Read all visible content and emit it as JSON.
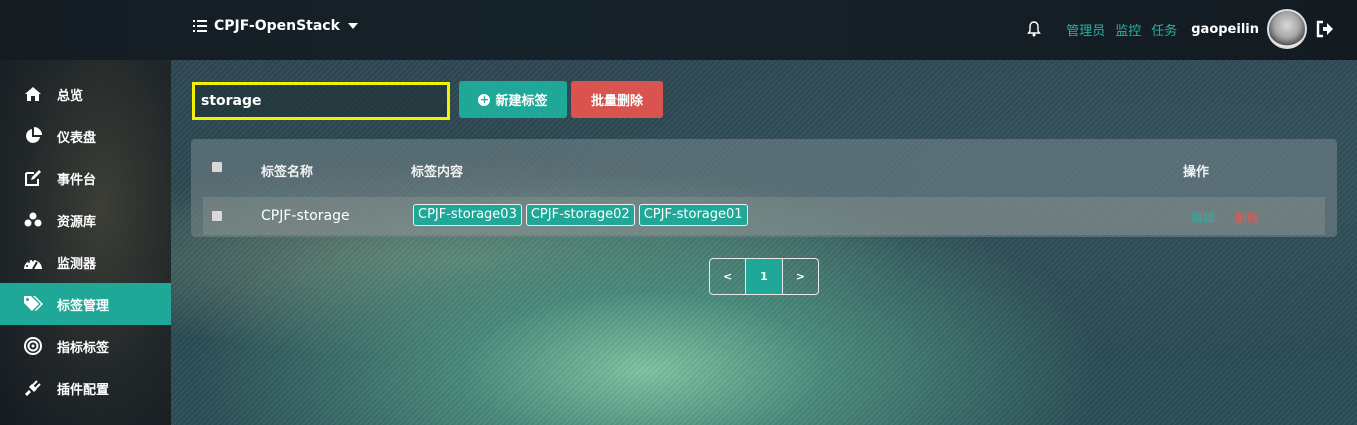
{
  "header": {
    "project": "CPJF-OpenStack",
    "links": [
      "管理员",
      "监控",
      "任务"
    ],
    "username": "gaopeilin"
  },
  "sidebar": {
    "items": [
      {
        "label": "总览",
        "icon": "home-icon"
      },
      {
        "label": "仪表盘",
        "icon": "pie-chart-icon"
      },
      {
        "label": "事件台",
        "icon": "edit-icon"
      },
      {
        "label": "资源库",
        "icon": "cubes-icon"
      },
      {
        "label": "监测器",
        "icon": "dashboard-icon"
      },
      {
        "label": "标签管理",
        "icon": "tags-icon",
        "active": true
      },
      {
        "label": "指标标签",
        "icon": "target-icon"
      },
      {
        "label": "插件配置",
        "icon": "plug-icon"
      }
    ]
  },
  "toolbar": {
    "search_value": "storage",
    "new_label": "新建标签",
    "batch_delete_label": "批量删除"
  },
  "table": {
    "columns": [
      "标签名称",
      "标签内容",
      "操作"
    ],
    "rows": [
      {
        "name": "CPJF-storage",
        "tags": [
          "CPJF-storage03",
          "CPJF-storage02",
          "CPJF-storage01"
        ],
        "edit": "编辑",
        "delete": "删除"
      }
    ]
  },
  "pagination": {
    "prev": "<",
    "current": "1",
    "next": ">"
  },
  "colors": {
    "accent": "#1fa898",
    "danger": "#d9534f",
    "highlight": "#f2f200"
  }
}
